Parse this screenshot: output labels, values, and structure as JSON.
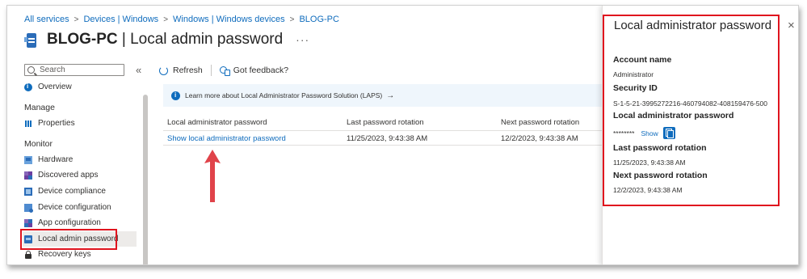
{
  "breadcrumb": {
    "items": [
      "All services",
      "Devices | Windows",
      "Windows | Windows devices",
      "BLOG-PC"
    ],
    "separator": ">"
  },
  "header": {
    "device_name": "BLOG-PC",
    "separator": " | ",
    "page_name": "Local admin password",
    "more_label": "···"
  },
  "sidebar": {
    "search_placeholder": "Search",
    "collapse_label": "«",
    "overview": "Overview",
    "manage_label": "Manage",
    "properties": "Properties",
    "monitor_label": "Monitor",
    "items": [
      {
        "label": "Hardware",
        "icon": "hardware-icon"
      },
      {
        "label": "Discovered apps",
        "icon": "apps-icon"
      },
      {
        "label": "Device compliance",
        "icon": "compliance-icon"
      },
      {
        "label": "Device configuration",
        "icon": "configuration-icon"
      },
      {
        "label": "App configuration",
        "icon": "app-configuration-icon"
      },
      {
        "label": "Local admin password",
        "icon": "laptop-icon",
        "active": true
      },
      {
        "label": "Recovery keys",
        "icon": "lock-icon"
      }
    ]
  },
  "toolbar": {
    "refresh_label": "Refresh",
    "feedback_label": "Got feedback?"
  },
  "banner": {
    "text": "Learn more about Local Administrator Password Solution (LAPS)",
    "arrow": "→"
  },
  "table": {
    "columns": [
      "Local administrator password",
      "Last password rotation",
      "Next password rotation"
    ],
    "rows": [
      {
        "password_link": "Show local administrator password",
        "last_rotation": "11/25/2023, 9:43:38 AM",
        "next_rotation": "12/2/2023, 9:43:38 AM"
      }
    ]
  },
  "panel": {
    "title": "Local administrator password",
    "close_label": "×",
    "account_name_label": "Account name",
    "account_name": "Administrator",
    "security_id_label": "Security ID",
    "security_id": "S-1-5-21-3995272216-460794082-408159476-500",
    "password_label": "Local administrator password",
    "password_masked": "********",
    "show_label": "Show",
    "last_rotation_label": "Last password rotation",
    "last_rotation": "11/25/2023, 9:43:38 AM",
    "next_rotation_label": "Next password rotation",
    "next_rotation": "12/2/2023, 9:43:38 AM"
  },
  "colors": {
    "accent": "#0f6cbd",
    "highlight": "#e0141e",
    "active_nav": "#edebe9",
    "banner_bg": "#eff6fc"
  }
}
